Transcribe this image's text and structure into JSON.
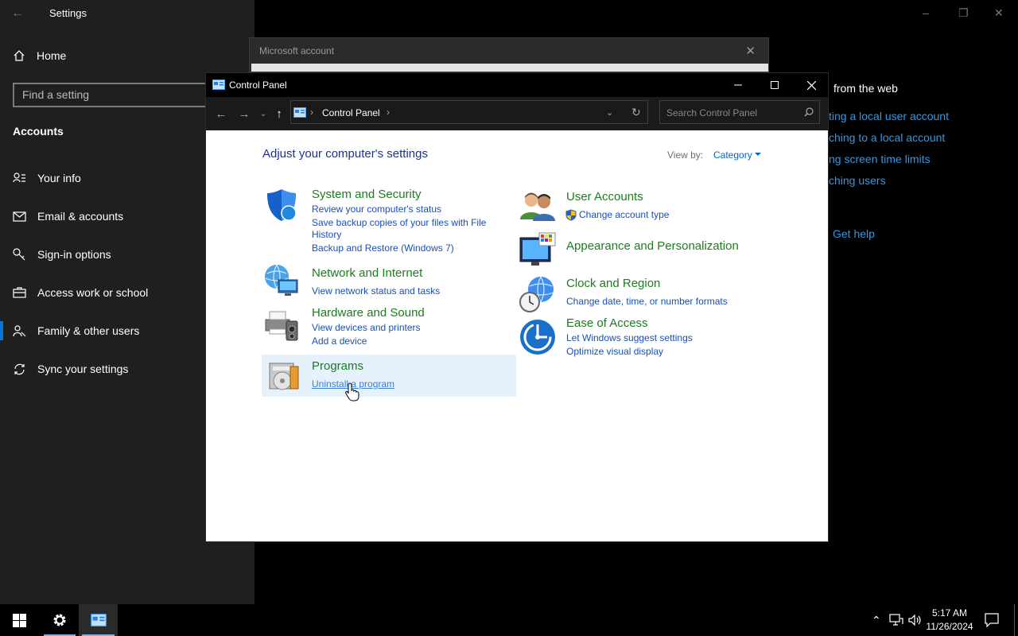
{
  "settings": {
    "title": "Settings",
    "home_label": "Home",
    "search_placeholder": "Find a setting",
    "section_title": "Accounts",
    "nav_items": [
      {
        "label": "Your info",
        "icon": "person-icon"
      },
      {
        "label": "Email & accounts",
        "icon": "mail-icon"
      },
      {
        "label": "Sign-in options",
        "icon": "key-icon"
      },
      {
        "label": "Access work or school",
        "icon": "briefcase-icon"
      },
      {
        "label": "Family & other users",
        "icon": "people-icon",
        "active": true
      },
      {
        "label": "Sync your settings",
        "icon": "sync-icon"
      }
    ],
    "main": {
      "web_heading_partial": "from the web",
      "links_partial": [
        "ting a local user account",
        "ching to a local account",
        "ng screen time limits",
        "ching users"
      ],
      "get_help": "Get help"
    }
  },
  "ms_dialog": {
    "title": "Microsoft account"
  },
  "control_panel": {
    "window_title": "Control Panel",
    "address_path": "Control Panel",
    "search_placeholder": "Search Control Panel",
    "heading": "Adjust your computer's settings",
    "view_by_label": "View by:",
    "view_by_value": "Category",
    "categories_left": [
      {
        "title": "System and Security",
        "icon": "shield-icon",
        "links": [
          "Review your computer's status",
          "Save backup copies of your files with File",
          "History",
          "Backup and Restore (Windows 7)"
        ]
      },
      {
        "title": "Network and Internet",
        "icon": "network-globe-icon",
        "links": [
          "View network status and tasks"
        ]
      },
      {
        "title": "Hardware and Sound",
        "icon": "printer-speaker-icon",
        "links": [
          "View devices and printers",
          "Add a device"
        ]
      },
      {
        "title": "Programs",
        "icon": "programs-disc-icon",
        "links": [
          "Uninstall a program"
        ]
      }
    ],
    "categories_right": [
      {
        "title": "User Accounts",
        "icon": "users-icon",
        "links": [
          "Change account type"
        ]
      },
      {
        "title": "Appearance and Personalization",
        "icon": "monitor-palette-icon",
        "links": []
      },
      {
        "title": "Clock and Region",
        "icon": "clock-globe-icon",
        "links": [
          "Change date, time, or number formats"
        ]
      },
      {
        "title": "Ease of Access",
        "icon": "ease-of-access-icon",
        "links": [
          "Let Windows suggest settings",
          "Optimize visual display"
        ]
      }
    ]
  },
  "taskbar": {
    "time": "5:17 AM",
    "date": "11/26/2024"
  }
}
